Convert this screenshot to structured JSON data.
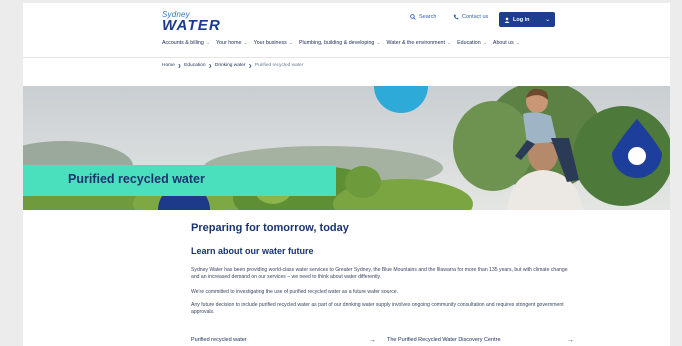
{
  "logo": {
    "line1": "Sydney",
    "line2": "WATER"
  },
  "utility": {
    "search_label": "Search",
    "contact_label": "Contact us",
    "login_label": "Log in"
  },
  "nav": {
    "items": [
      {
        "label": "Accounts & billing"
      },
      {
        "label": "Your home"
      },
      {
        "label": "Your business"
      },
      {
        "label": "Plumbing, building & developing"
      },
      {
        "label": "Water & the environment"
      },
      {
        "label": "Education"
      },
      {
        "label": "About us"
      }
    ]
  },
  "breadcrumb": {
    "items": [
      "Home",
      "Education",
      "Drinking water"
    ],
    "current": "Purified recycled water"
  },
  "hero": {
    "title": "Purified recycled water",
    "band_color": "#4be0bd"
  },
  "content": {
    "heading": "Preparing for tomorrow, today",
    "subheading": "Learn about our water future",
    "paragraphs": [
      "Sydney Water has been providing world-class water services to Greater Sydney, the Blue Mountains and the Illawarra for more than 135 years, but with climate change and an increased demand on our services – we need to think about water differently.",
      "We're committed to investigating the use of purified recycled water as a future water source.",
      "Any future decision to include purified recycled water as part of our drinking water supply involves ongoing community consultation and requires stringent government approvals."
    ]
  },
  "links": [
    {
      "label": "Purified recycled water",
      "arrow": "→"
    },
    {
      "label": "The Purified Recycled Water Discovery Centre",
      "arrow": "→"
    }
  ],
  "colors": {
    "brand_navy": "#1d3e8f",
    "brand_blue": "#2f79c5",
    "accent_teal": "#4be0bd"
  }
}
